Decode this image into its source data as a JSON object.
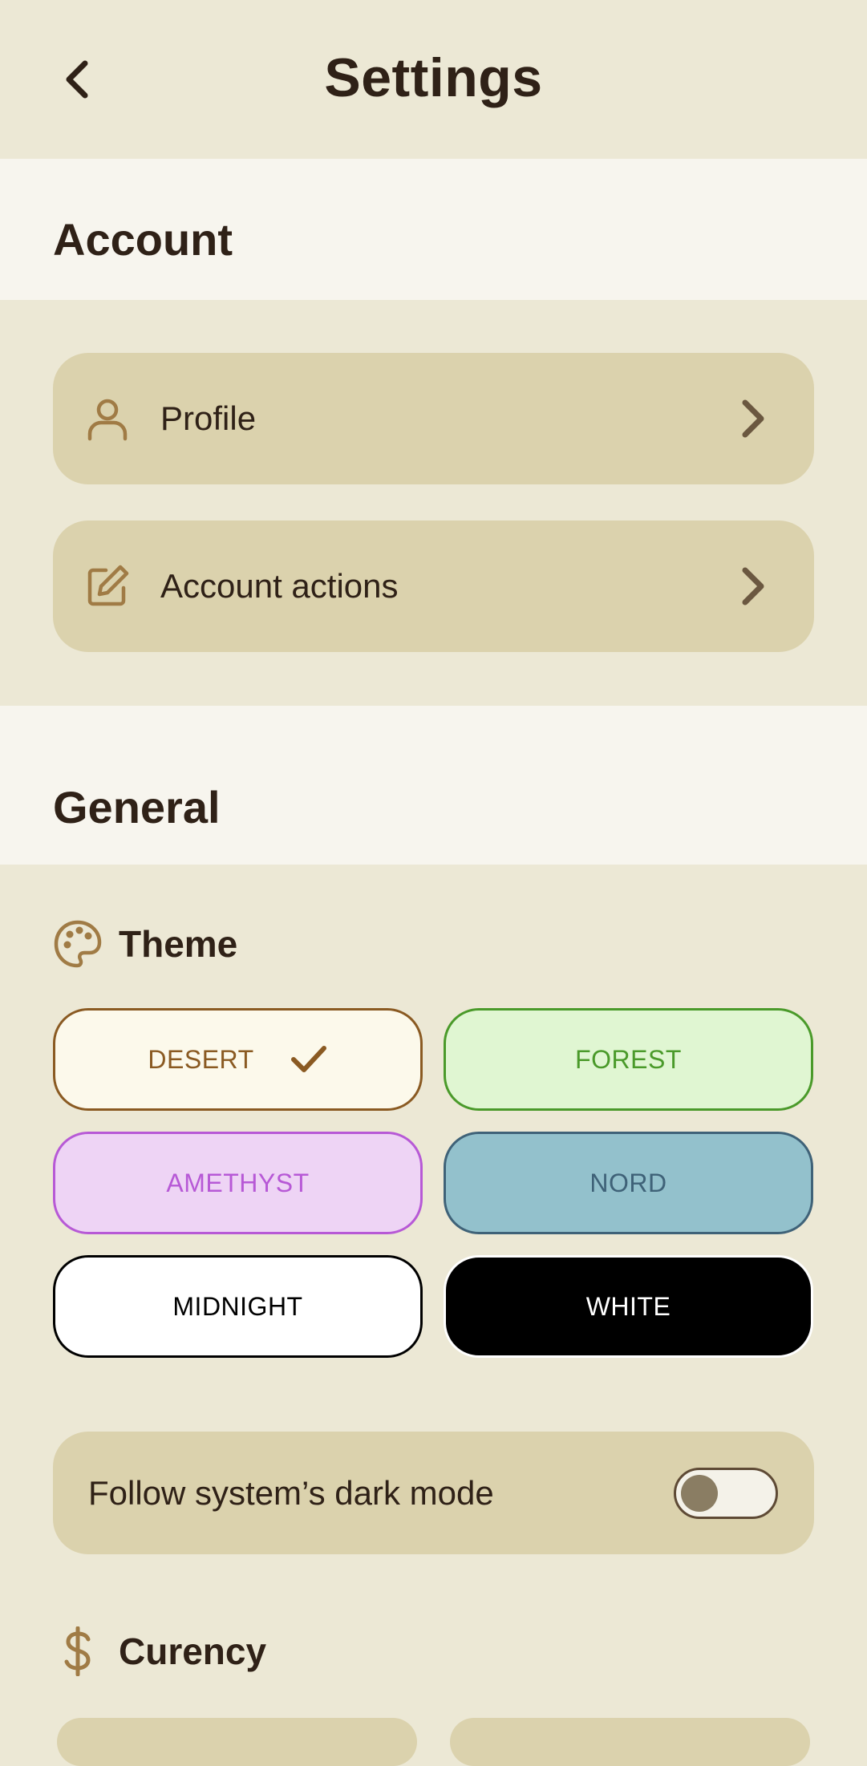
{
  "header": {
    "title": "Settings",
    "back_icon": "chevron-left-icon"
  },
  "account": {
    "section_label": "Account",
    "items": [
      {
        "label": "Profile",
        "icon": "user-icon"
      },
      {
        "label": "Account actions",
        "icon": "edit-icon"
      }
    ]
  },
  "general": {
    "section_label": "General",
    "theme": {
      "label": "Theme",
      "icon": "palette-icon",
      "selected": "DESERT",
      "options": [
        {
          "label": "DESERT",
          "bg": "#fcf9eb",
          "border": "#8a5a22",
          "text": "#8a5a22"
        },
        {
          "label": "FOREST",
          "bg": "#e0f6d2",
          "border": "#4a9a2a",
          "text": "#4a9a2a"
        },
        {
          "label": "AMETHYST",
          "bg": "#eed4f5",
          "border": "#b759d6",
          "text": "#b759d6"
        },
        {
          "label": "NORD",
          "bg": "#93c1cc",
          "border": "#3f6278",
          "text": "#3f6278"
        },
        {
          "label": "MIDNIGHT",
          "bg": "#ffffff",
          "border": "#000000",
          "text": "#000000"
        },
        {
          "label": "WHITE",
          "bg": "#000000",
          "border": "#ffffff",
          "text": "#ffffff"
        }
      ]
    },
    "dark_mode": {
      "label": "Follow system’s dark mode",
      "enabled": false
    },
    "currency": {
      "label": "Curency",
      "icon": "dollar-icon"
    }
  },
  "colors": {
    "background": "#ece8d5",
    "section_header_bg": "#f7f5ee",
    "card_bg": "#dbd2ad",
    "accent": "#a07b45",
    "text": "#2f2117"
  }
}
